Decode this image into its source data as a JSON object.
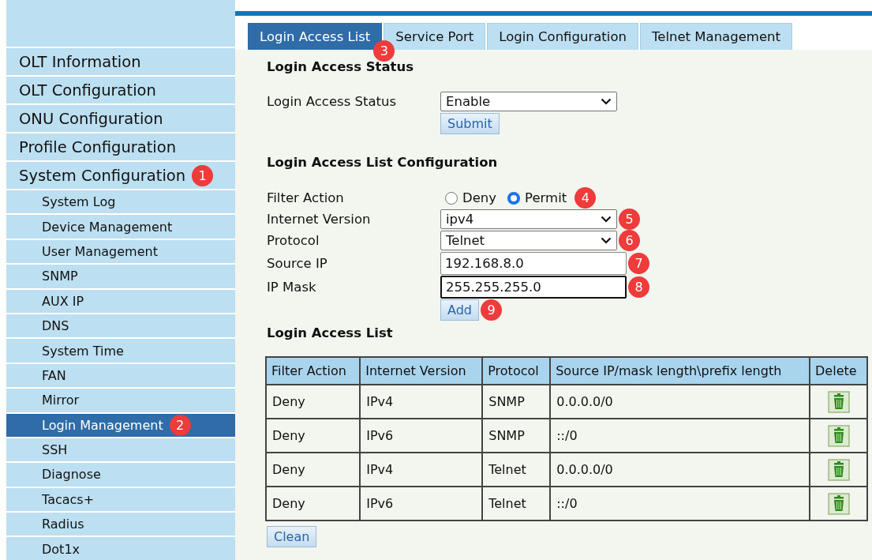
{
  "sidebar": {
    "items": [
      {
        "label": "OLT Information",
        "selected": false
      },
      {
        "label": "OLT Configuration",
        "selected": false
      },
      {
        "label": "ONU Configuration",
        "selected": false
      },
      {
        "label": "Profile Configuration",
        "selected": false
      },
      {
        "label": "System Configuration",
        "selected": false,
        "badge": "1",
        "children": [
          {
            "label": "System Log",
            "selected": false
          },
          {
            "label": "Device Management",
            "selected": false
          },
          {
            "label": "User Management",
            "selected": false
          },
          {
            "label": "SNMP",
            "selected": false
          },
          {
            "label": "AUX IP",
            "selected": false
          },
          {
            "label": "DNS",
            "selected": false
          },
          {
            "label": "System Time",
            "selected": false
          },
          {
            "label": "FAN",
            "selected": false
          },
          {
            "label": "Mirror",
            "selected": false
          },
          {
            "label": "Login Management",
            "selected": true,
            "badge": "2"
          },
          {
            "label": "SSH",
            "selected": false
          },
          {
            "label": "Diagnose",
            "selected": false
          },
          {
            "label": "Tacacs+",
            "selected": false
          },
          {
            "label": "Radius",
            "selected": false
          },
          {
            "label": "Dot1x",
            "selected": false
          }
        ]
      }
    ]
  },
  "tabs": [
    {
      "label": "Login Access List",
      "selected": true,
      "badge": "3"
    },
    {
      "label": "Service Port",
      "selected": false
    },
    {
      "label": "Login Configuration",
      "selected": false
    },
    {
      "label": "Telnet Management",
      "selected": false
    }
  ],
  "status_section": {
    "title": "Login Access Status",
    "label": "Login Access Status",
    "value": "Enable",
    "button": "Submit"
  },
  "config_section": {
    "title": "Login Access List Configuration",
    "fields": [
      {
        "kind": "radio",
        "label": "Filter Action",
        "badge": "4",
        "options": [
          {
            "label": "Deny",
            "selected": false
          },
          {
            "label": "Permit",
            "selected": true
          }
        ]
      },
      {
        "kind": "select",
        "label": "Internet Version",
        "value": "ipv4",
        "badge": "5"
      },
      {
        "kind": "select",
        "label": "Protocol",
        "value": "Telnet",
        "badge": "6"
      },
      {
        "kind": "input",
        "label": "Source IP",
        "value": "192.168.8.0",
        "badge": "7",
        "focused": false
      },
      {
        "kind": "input",
        "label": "IP Mask",
        "value": "255.255.255.0",
        "badge": "8",
        "focused": true
      }
    ],
    "button": "Add",
    "button_badge": "9"
  },
  "list_section": {
    "title": "Login Access List",
    "columns": [
      "Filter Action",
      "Internet Version",
      "Protocol",
      "Source IP/mask length\\prefix length",
      "Delete"
    ],
    "rows": [
      [
        "Deny",
        "IPv4",
        "SNMP",
        "0.0.0.0/0"
      ],
      [
        "Deny",
        "IPv6",
        "SNMP",
        "::/0"
      ],
      [
        "Deny",
        "IPv4",
        "Telnet",
        "0.0.0.0/0"
      ],
      [
        "Deny",
        "IPv6",
        "Telnet",
        "::/0"
      ]
    ],
    "button": "Clean"
  }
}
